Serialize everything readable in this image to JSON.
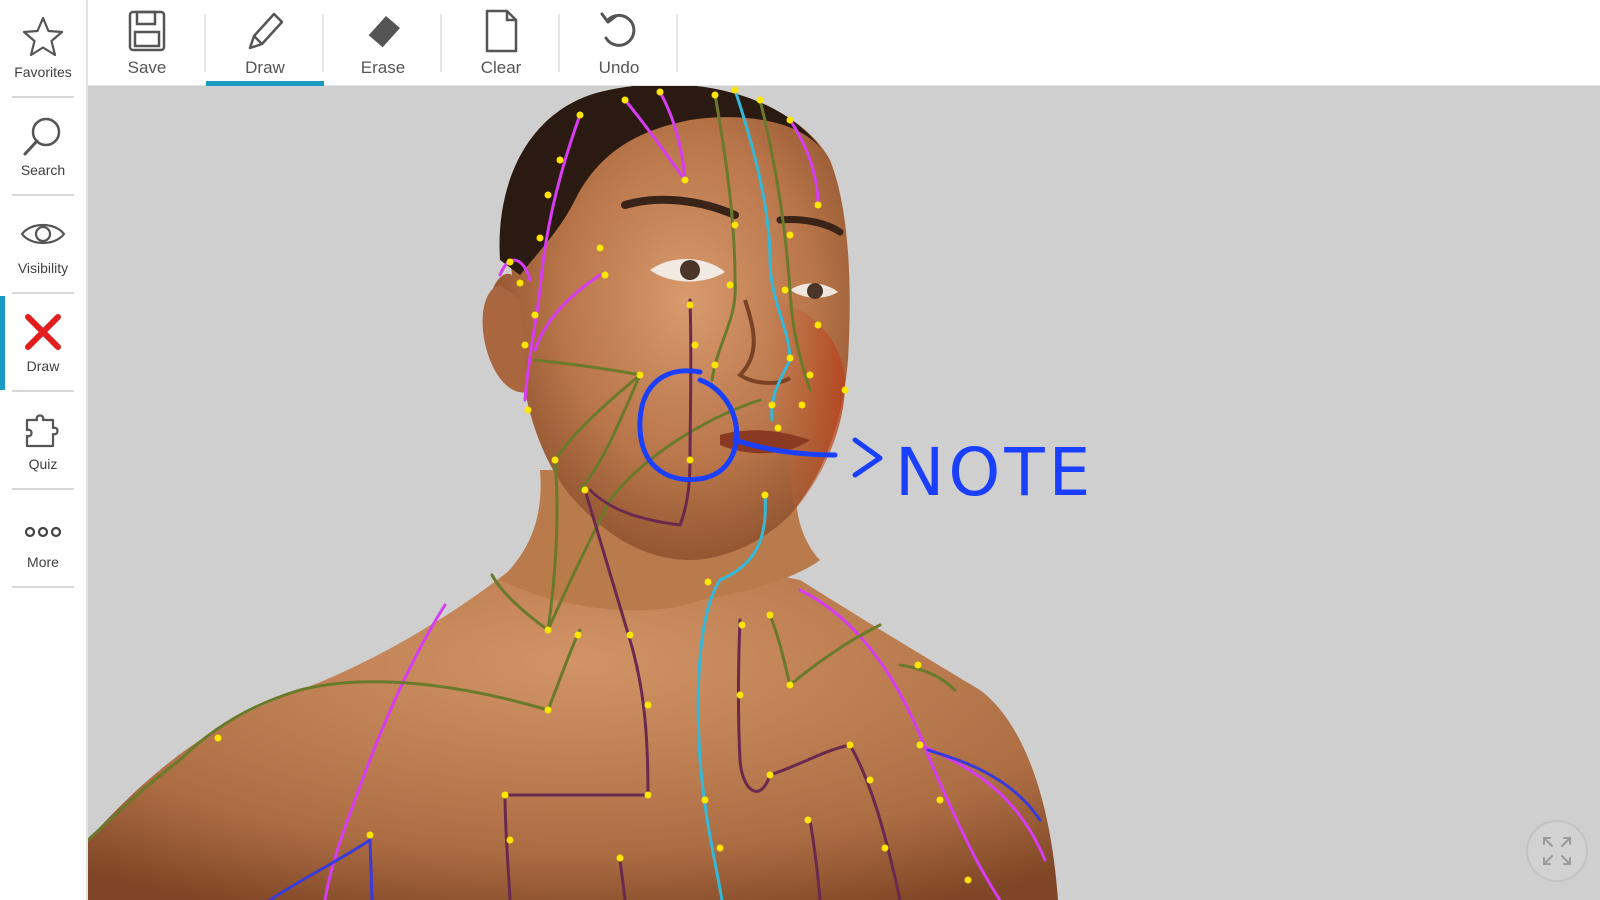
{
  "sidebar": {
    "items": [
      {
        "label": "Favorites",
        "icon": "star-icon"
      },
      {
        "label": "Search",
        "icon": "search-icon"
      },
      {
        "label": "Visibility",
        "icon": "eye-icon"
      },
      {
        "label": "Draw",
        "icon": "close-icon",
        "active": true
      },
      {
        "label": "Quiz",
        "icon": "puzzle-icon"
      },
      {
        "label": "More",
        "icon": "more-icon"
      }
    ]
  },
  "toolbar": {
    "items": [
      {
        "label": "Save",
        "icon": "floppy-disk-icon"
      },
      {
        "label": "Draw",
        "icon": "pencil-icon",
        "active": true
      },
      {
        "label": "Erase",
        "icon": "eraser-icon"
      },
      {
        "label": "Clear",
        "icon": "blank-page-icon"
      },
      {
        "label": "Undo",
        "icon": "undo-icon"
      }
    ]
  },
  "canvas": {
    "annotation_text": "NOTE",
    "ink_color": "#1a3fff"
  },
  "colors": {
    "accent": "#1a9bc4",
    "draw_icon": "#e11d1d",
    "viewport_bg": "#cfcfcf",
    "meridian_magenta": "#d63cf0",
    "meridian_olive": "#6b7a2a",
    "meridian_cyan": "#34b8d8",
    "meridian_purple": "#6a2a4e",
    "acupoint": "#ffe600"
  },
  "controls": {
    "fullscreen_icon": "expand-arrows-icon"
  }
}
